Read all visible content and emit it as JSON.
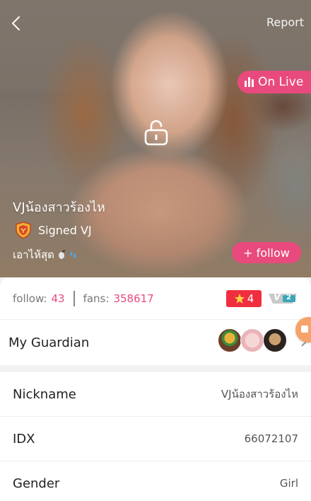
{
  "header": {
    "report_label": "Report",
    "live_label": "On Live",
    "vj_name": "VJน้องสาวร้องไห",
    "signed_label": "Signed VJ",
    "motto": "เอาไห้สุด",
    "follow_label": "+ follow"
  },
  "stats": {
    "follow_label": "follow:",
    "follow_value": "43",
    "fans_label": "fans:",
    "fans_value": "358617",
    "level": "4",
    "vip_label": "V",
    "vip_level": "2"
  },
  "guardian": {
    "label": "My Guardian"
  },
  "profile": {
    "rows": [
      {
        "label": "Nickname",
        "value": "VJน้องสาวร้องไห"
      },
      {
        "label": "IDX",
        "value": "66072107"
      },
      {
        "label": "Gender",
        "value": "Girl"
      }
    ]
  },
  "colors": {
    "accent": "#e94a7d",
    "level_badge": "#ef2f3f"
  },
  "icons": [
    "back-arrow-icon",
    "live-bars-icon",
    "unlock-icon",
    "shield-icon",
    "star-icon",
    "chevron-right-icon"
  ]
}
